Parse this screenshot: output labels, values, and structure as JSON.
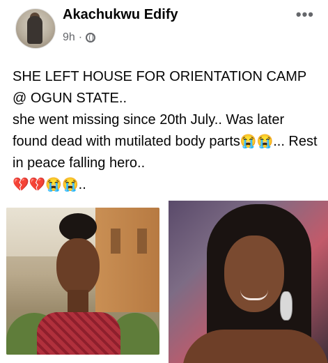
{
  "post": {
    "author": "Akachukwu Edify",
    "time": "9h",
    "separator": "·",
    "privacy_icon": "globe-icon",
    "more_icon": "more-options-icon",
    "more_label": "•••",
    "text_line1": "SHE LEFT HOUSE FOR ORIENTATION CAMP @ OGUN STATE..",
    "text_line2_prefix": "she went missing since 20th July.. Was later found dead with mutilated body parts",
    "text_line2_emoji": "😭😭",
    "text_line2_suffix": "... Rest in peace falling hero..",
    "text_line3_emoji": "💔💔😭😭",
    "text_line3_suffix": ".."
  },
  "photos": [
    {
      "name": "photo-left",
      "description_icon": "photo-icon"
    },
    {
      "name": "photo-right",
      "description_icon": "photo-icon"
    }
  ],
  "colors": {
    "text": "#050505",
    "secondary": "#65676b",
    "background": "#ffffff"
  }
}
